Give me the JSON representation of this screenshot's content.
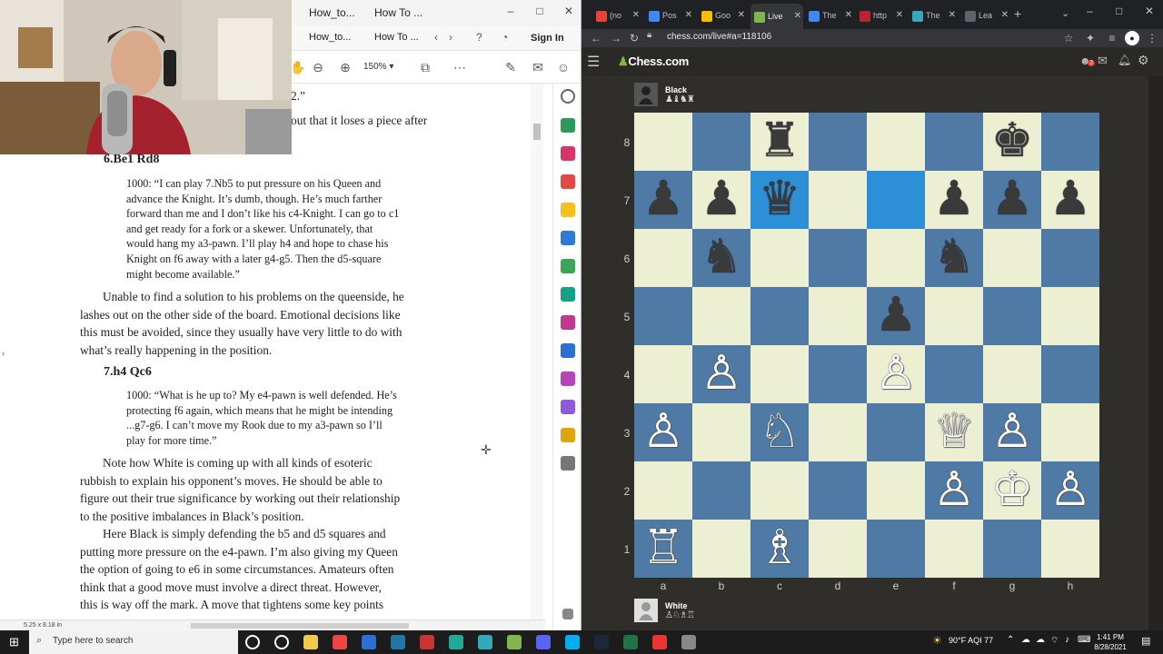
{
  "pdf": {
    "tabs": [
      "How_to...",
      "How To ..."
    ],
    "sign_in": "Sign In",
    "zoom": "150%",
    "page_size": "5.25 x 8.18 in",
    "content": {
      "line0": "2.”",
      "line1": "out that it loses a piece after",
      "move6": "6.Be1 Rd8",
      "q6": [
        "1000: “I can play 7.Nb5 to put pressure on his Queen and",
        "advance the Knight. It’s dumb, though. He’s much farther",
        "forward than me and I don’t like his c4-Knight. I can go to c1",
        "and get ready for a fork or a skewer. Unfortunately, that",
        "would hang my a3-pawn. I’ll play h4 and hope to chase his",
        "Knight on f6 away with a later g4-g5. Then the d5-square",
        "might become available.”"
      ],
      "p1": [
        "Unable to find a solution to his problems on the queenside, he",
        "lashes out on the other side of the board. Emotional decisions like",
        "this must be avoided, since they usually have very little to do with",
        "what’s really happening in the position."
      ],
      "move7": "7.h4 Qc6",
      "q7": [
        "1000: “What is he up to? My e4-pawn is well defended. He’s",
        "protecting f6 again, which means that he might be intending",
        "...g7-g6. I can’t move my Rook due to my a3-pawn so I’ll",
        "play for more time.”"
      ],
      "p2": [
        "Note how White is coming up with all kinds of esoteric",
        "rubbish to explain his opponent’s moves. He should be able to",
        "figure out their true significance by working out their relationship",
        "to the positive imbalances in Black’s position."
      ],
      "p3": [
        "Here Black is simply defending the b5 and d5 squares and",
        "putting more pressure on the e4-pawn. I’m also giving my Queen",
        "the option of going to e6 in some circumstances. Amateurs often",
        "think that a good move must involve a direct threat. However,",
        "this is way off the mark. A move that tightens some key points"
      ]
    }
  },
  "browser": {
    "tabs": [
      {
        "label": "(no",
        "color": "#ea4335"
      },
      {
        "label": "Pos",
        "color": "#4285f4"
      },
      {
        "label": "Goo",
        "color": "#fbbc04"
      },
      {
        "label": "Live",
        "color": "#81b64c"
      },
      {
        "label": "The",
        "color": "#4285f4"
      },
      {
        "label": "http",
        "color": "#b23"
      },
      {
        "label": "The",
        "color": "#3aa6b9"
      },
      {
        "label": "Lea",
        "color": "#5f6368"
      }
    ],
    "url": "chess.com/live#a=118106",
    "brand": "Chess.com",
    "notif_count": "3"
  },
  "game": {
    "top_player": {
      "name": "Black",
      "captured": "♟♝♞♜"
    },
    "bottom_player": {
      "name": "White",
      "captured": "♙♘♗♖"
    },
    "files": [
      "a",
      "b",
      "c",
      "d",
      "e",
      "f",
      "g",
      "h"
    ],
    "ranks": [
      "8",
      "7",
      "6",
      "5",
      "4",
      "3",
      "2",
      "1"
    ],
    "highlight": [
      "c7",
      "e7"
    ],
    "pieces": [
      {
        "sq": "c8",
        "p": "b",
        "t": "♜"
      },
      {
        "sq": "g8",
        "p": "b",
        "t": "♚"
      },
      {
        "sq": "a7",
        "p": "b",
        "t": "♟"
      },
      {
        "sq": "b7",
        "p": "b",
        "t": "♟"
      },
      {
        "sq": "c7",
        "p": "b",
        "t": "♛"
      },
      {
        "sq": "f7",
        "p": "b",
        "t": "♟"
      },
      {
        "sq": "g7",
        "p": "b",
        "t": "♟"
      },
      {
        "sq": "h7",
        "p": "b",
        "t": "♟"
      },
      {
        "sq": "b6",
        "p": "b",
        "t": "♞"
      },
      {
        "sq": "f6",
        "p": "b",
        "t": "♞"
      },
      {
        "sq": "e5",
        "p": "b",
        "t": "♟"
      },
      {
        "sq": "b4",
        "p": "w",
        "t": "♙"
      },
      {
        "sq": "e4",
        "p": "w",
        "t": "♙"
      },
      {
        "sq": "a3",
        "p": "w",
        "t": "♙"
      },
      {
        "sq": "c3",
        "p": "w",
        "t": "♘"
      },
      {
        "sq": "f3",
        "p": "w",
        "t": "♕"
      },
      {
        "sq": "g3",
        "p": "w",
        "t": "♙"
      },
      {
        "sq": "f2",
        "p": "w",
        "t": "♙"
      },
      {
        "sq": "g2",
        "p": "w",
        "t": "♔"
      },
      {
        "sq": "h2",
        "p": "w",
        "t": "♙"
      },
      {
        "sq": "a1",
        "p": "w",
        "t": "♖"
      },
      {
        "sq": "c1",
        "p": "w",
        "t": "♗"
      }
    ]
  },
  "taskbar": {
    "search_placeholder": "Type here to search",
    "weather": "90°F  AQI 77",
    "time": "1:41 PM",
    "date": "8/28/2021",
    "apps": [
      "#3b3b3b",
      "#3b3b3b",
      "#f2c94c",
      "#e44",
      "#2a6fd6",
      "#27a",
      "#c33",
      "#2a9",
      "#3ab",
      "#81b64c",
      "#5865f2",
      "#00aff0",
      "#1b2838",
      "#217346",
      "#e33",
      "#888"
    ]
  }
}
